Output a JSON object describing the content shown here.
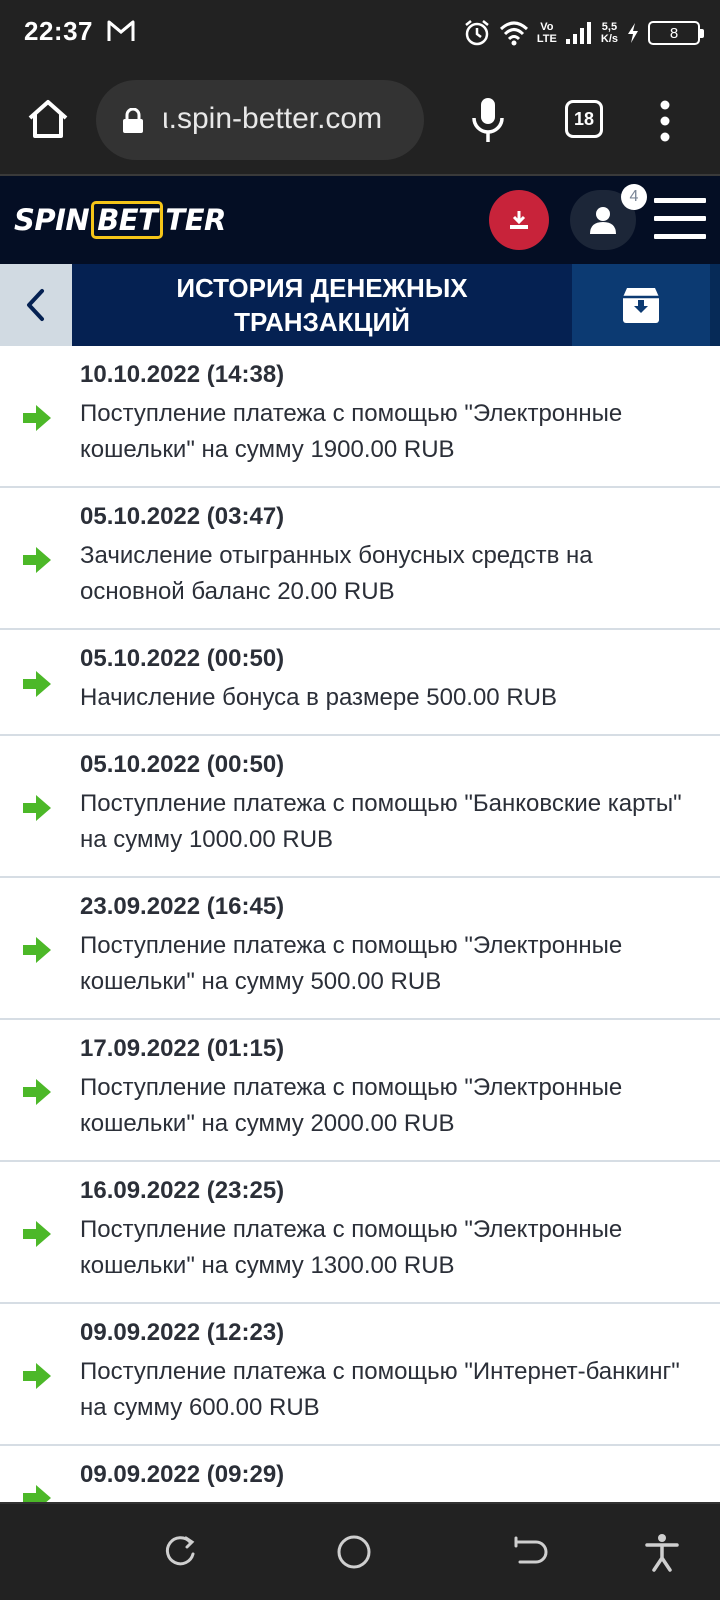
{
  "status_bar": {
    "time": "22:37",
    "network_speed_top": "5,5",
    "network_speed_bottom": "K/s",
    "volte_top": "Vo",
    "volte_bottom": "LTE",
    "battery_level": "8",
    "icons": [
      "gmail-icon",
      "alarm-icon",
      "wifi-icon",
      "signal-icon",
      "charging-icon",
      "battery-icon"
    ]
  },
  "browser": {
    "url": "ι.spin-better.com",
    "tab_count": "18"
  },
  "site_header": {
    "logo_part1": "SPIN",
    "logo_part2": "BET",
    "logo_part3": "TER",
    "notification_count": "4",
    "colors": {
      "background": "#040e24",
      "download_button": "#c8233a",
      "logo_accent": "#f5c518"
    }
  },
  "page": {
    "title": "ИСТОРИЯ ДЕНЕЖНЫХ ТРАНЗАКЦИЙ"
  },
  "transactions": [
    {
      "date": "10.10.2022 (14:38)",
      "description": "Поступление платежа с помощью \"Электронные кошельки\" на сумму 1900.00 RUB"
    },
    {
      "date": "05.10.2022 (03:47)",
      "description": "Зачисление отыгранных бонусных средств на основной баланс 20.00 RUB"
    },
    {
      "date": "05.10.2022 (00:50)",
      "description": "Начисление бонуса в размере 500.00 RUB"
    },
    {
      "date": "05.10.2022 (00:50)",
      "description": "Поступление платежа с помощью \"Банковские карты\" на сумму 1000.00 RUB"
    },
    {
      "date": "23.09.2022 (16:45)",
      "description": "Поступление платежа с помощью \"Электронные кошельки\" на сумму 500.00 RUB"
    },
    {
      "date": "17.09.2022 (01:15)",
      "description": "Поступление платежа с помощью \"Электронные кошельки\" на сумму 2000.00 RUB"
    },
    {
      "date": "16.09.2022 (23:25)",
      "description": "Поступление платежа с помощью \"Электронные кошельки\" на сумму 1300.00 RUB"
    },
    {
      "date": "09.09.2022 (12:23)",
      "description": "Поступление платежа с помощью \"Интернет-банкинг\" на сумму 600.00 RUB"
    },
    {
      "date": "09.09.2022 (09:29)",
      "description": ""
    }
  ],
  "accent_colors": {
    "arrow": "#4cb828",
    "title_bar": "#052152"
  },
  "nav_bar": {
    "icons": [
      "recent-apps-icon",
      "home-circle-icon",
      "back-nav-icon",
      "accessibility-icon"
    ]
  }
}
